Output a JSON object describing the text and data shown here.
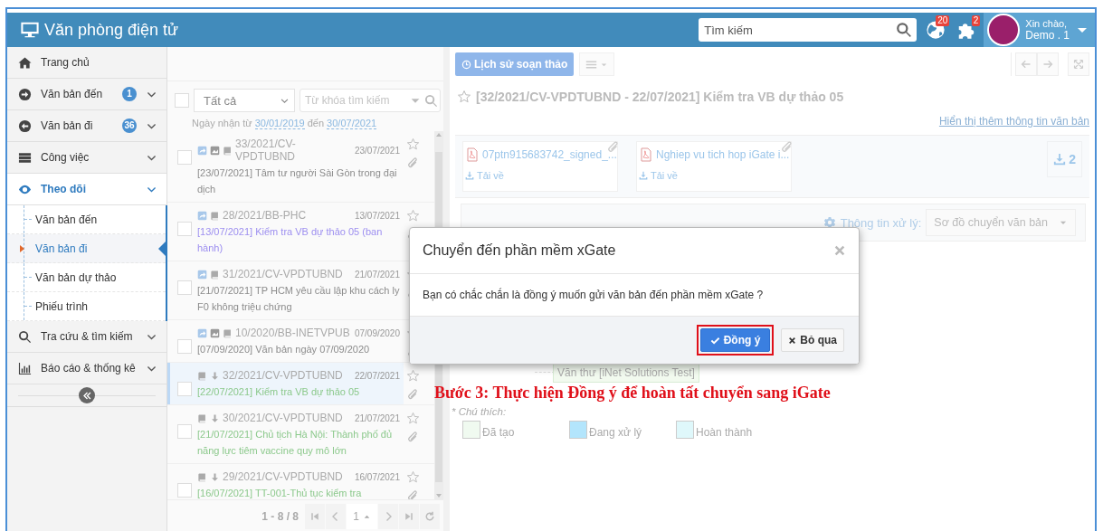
{
  "header": {
    "title": "Văn phòng điện tử",
    "search": {
      "placeholder": "Tìm kiếm"
    },
    "notifications": [
      {
        "kind": "globe",
        "count": "20"
      },
      {
        "kind": "puzzle",
        "count": "2"
      }
    ],
    "user": {
      "greeting": "Xin chào,",
      "name": "Demo . 1"
    }
  },
  "sidebar": {
    "items": [
      {
        "kind": "home",
        "label": "Trang chủ",
        "selected": false
      },
      {
        "kind": "incoming",
        "label": "Văn bản đến",
        "badge": "1",
        "expanded": false,
        "selected": false
      },
      {
        "kind": "outgoing",
        "label": "Văn bản đi",
        "badge": "36",
        "expanded": false,
        "selected": false
      },
      {
        "kind": "tasks",
        "label": "Công việc",
        "expanded": false,
        "selected": false
      },
      {
        "kind": "watch",
        "label": "Theo dõi",
        "expanded": true,
        "selected": true,
        "children": [
          {
            "label": "Văn bản đến",
            "selected": false
          },
          {
            "label": "Văn bản đi",
            "selected": true
          },
          {
            "label": "Văn bản dự thảo",
            "selected": false
          },
          {
            "label": "Phiếu trình",
            "selected": false
          }
        ]
      },
      {
        "kind": "lookup",
        "label": "Tra cứu & tìm kiếm",
        "expanded": false,
        "selected": false
      },
      {
        "kind": "report",
        "label": "Báo cáo & thống kê",
        "expanded": false,
        "selected": false
      }
    ]
  },
  "list": {
    "select_all": {
      "checked": false
    },
    "filter": {
      "value": "Tất cả"
    },
    "search": {
      "placeholder": "Từ khóa tìm kiếm"
    },
    "date_range": {
      "label": "Ngày nhận từ",
      "from": "30/01/2019",
      "connector": "đến",
      "to": "30/07/2021"
    },
    "items": [
      {
        "kind": "forwarded",
        "has_image": true,
        "number": "33/2021/CV-VPDTUBND",
        "date": "23/07/2021",
        "title": "[23/07/2021] Tâm tư người Sài Gòn trong đại dịch",
        "color": "#8c8c8c",
        "checked": false,
        "selected": false
      },
      {
        "kind": "forwarded",
        "has_image": false,
        "number": "28/2021/BB-PHC",
        "date": "13/07/2021",
        "title": "[13/07/2021] Kiểm tra VB dự thảo 05 (ban hành)",
        "color": "#9d8ff0",
        "checked": false,
        "selected": false
      },
      {
        "kind": "forwarded",
        "has_image": false,
        "number": "31/2021/CV-VPDTUBND",
        "date": "21/07/2021",
        "title": "[21/07/2021] TP HCM yêu cầu lập khu cách ly F0 không triệu chứng",
        "color": "#8c8c8c",
        "checked": false,
        "selected": false
      },
      {
        "kind": "forwarded",
        "has_image": true,
        "number": "10/2020/BB-INETVPUB",
        "date": "07/09/2020",
        "title": "[07/09/2020] Văn bản ngày 07/09/2020",
        "color": "#8c8c8c",
        "checked": false,
        "selected": false
      },
      {
        "kind": "received",
        "has_image": false,
        "number": "32/2021/CV-VPDTUBND",
        "date": "22/07/2021",
        "title": "[22/07/2021] Kiểm tra VB dự thảo 05",
        "color": "#8cc98c",
        "checked": false,
        "selected": true
      },
      {
        "kind": "received",
        "has_image": false,
        "number": "30/2021/CV-VPDTUBND",
        "date": "21/07/2021",
        "title": "[21/07/2021] Chủ tịch Hà Nội: Thành phố đủ năng lực tiêm vaccine quy mô lớn",
        "color": "#8cc98c",
        "checked": false,
        "selected": false
      },
      {
        "kind": "received",
        "has_image": false,
        "number": "29/2021/CV-VPDTUBND",
        "date": "16/07/2021",
        "title": "[16/07/2021] TT-001-Thủ tục kiểm tra",
        "color": "#8cc98c",
        "checked": false,
        "selected": false
      }
    ],
    "pager": {
      "summary": "1 - 8 / 8",
      "page": "1"
    }
  },
  "document": {
    "history_button": "Lịch sử soạn thảo",
    "title": "[32/2021/CV-VPDTUBND - 22/07/2021] Kiểm tra VB dự thảo 05",
    "more_link": "Hiển thị thêm thông tin văn bản",
    "attachments": [
      {
        "name": "07ptn915683742_signed_...",
        "download": "Tải về"
      },
      {
        "name": "Nghiep vu tich hop iGate i...",
        "download": "Tải về"
      }
    ],
    "download_count": "2",
    "processing": {
      "label": "Thông tin xử lý:",
      "view": "Sơ đồ chuyển văn bản",
      "nodes": [
        {
          "label": "Văn thư [iNet Solutions Test]",
          "kind": "created"
        }
      ],
      "legend_title": "* Chú thích:",
      "legend": [
        {
          "label": "Đã tạo",
          "color": "#f0faf0"
        },
        {
          "label": "Đang xử lý",
          "color": "#b3e5fc"
        },
        {
          "label": "Hoàn thành",
          "color": "#dff8fb"
        }
      ]
    }
  },
  "dialog": {
    "title": "Chuyển đến phần mềm xGate",
    "message": "Bạn có chắc chắn là đồng ý muốn gửi văn bản đến phần mềm xGate ?",
    "buttons": [
      {
        "label": "Đồng ý",
        "kind": "primary",
        "highlighted": true
      },
      {
        "label": "Bỏ qua",
        "kind": "cancel",
        "highlighted": false
      }
    ]
  },
  "annotation": {
    "text": "Bước 3: Thực hiện Đồng ý để hoàn tất chuyển sang iGate"
  }
}
